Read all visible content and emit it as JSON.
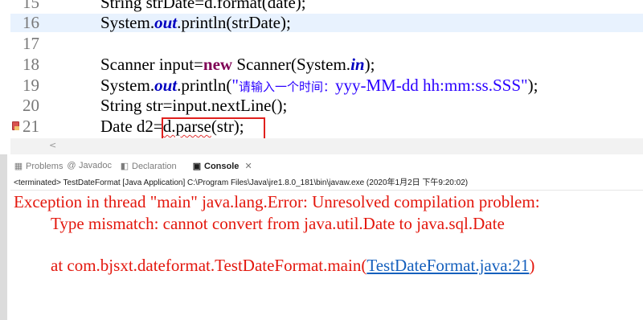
{
  "editor": {
    "lines": [
      {
        "num": "15",
        "code": "String strDate=d.format(date);"
      },
      {
        "num": "16",
        "pre": "System.",
        "field": "out",
        "post": ".println(strDate);"
      },
      {
        "num": "17",
        "code": ""
      },
      {
        "num": "18",
        "pre": "Scanner input=",
        "kw": "new",
        "mid": " Scanner(System.",
        "field": "in",
        "post": ");"
      },
      {
        "num": "19",
        "pre": "System.",
        "field": "out",
        "mid": ".println(",
        "str_open": "\"",
        "str_cjk": "请输入一个时间：",
        "str_rest": "yyy-MM-dd hh:mm:ss.SSS\"",
        "post": ");"
      },
      {
        "num": "20",
        "code": "String str=input.nextLine();"
      },
      {
        "num": "21",
        "pre": "Date d2=",
        "squiggle": "d.parse",
        "post": "(str);"
      }
    ],
    "scroll_left_glyph": "<"
  },
  "views": {
    "tabs": [
      {
        "label": "Problems",
        "icon": "problems-icon",
        "glyph": "▦",
        "close": ""
      },
      {
        "label": "Javadoc",
        "icon": "javadoc-icon",
        "glyph": "@",
        "close": ""
      },
      {
        "label": "Declaration",
        "icon": "declaration-icon",
        "glyph": "◧",
        "close": ""
      },
      {
        "label": "Console",
        "icon": "console-icon",
        "glyph": "▣",
        "close": "✕"
      }
    ]
  },
  "console": {
    "path": "<terminated> TestDateFormat [Java Application] C:\\Program Files\\Java\\jre1.8.0_181\\bin\\javaw.exe (2020年1月2日 下午9:20:02)",
    "line1": "Exception in thread \"main\" java.lang.Error: Unresolved compilation problem: ",
    "line2": "Type mismatch: cannot convert from java.util.Date to java.sql.Date",
    "line3_prefix": "at com.bjsxt.dateformat.TestDateFormat.main(",
    "line3_link": "TestDateFormat.java:21",
    "line3_suffix": ")"
  },
  "colors": {
    "error_text": "#e3170d",
    "current_line": "#e8f2fe",
    "highlight_box": "#e0201d"
  }
}
